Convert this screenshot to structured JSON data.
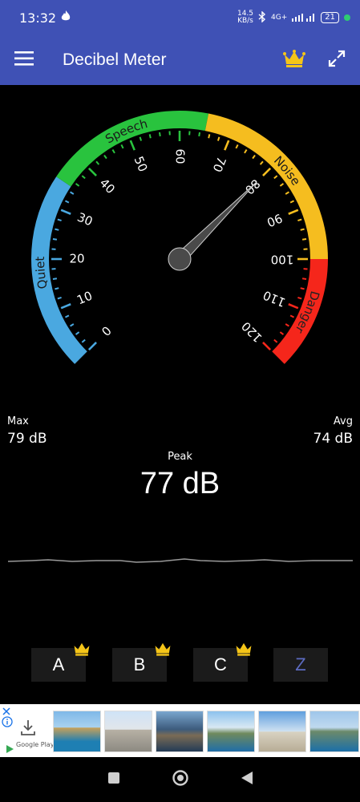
{
  "status": {
    "time": "13:32",
    "net_speed_top": "14.5",
    "net_speed_bottom": "KB/s",
    "network": "4G+",
    "battery": "21"
  },
  "appbar": {
    "title": "Decibel Meter",
    "menu_icon": "hamburger-menu-icon",
    "premium_icon": "crown-icon",
    "fullscreen_icon": "expand-icon"
  },
  "gauge": {
    "min": 0,
    "max": 120,
    "needle_value": 80,
    "ticks": [
      "0",
      "10",
      "20",
      "30",
      "40",
      "50",
      "60",
      "70",
      "80",
      "90",
      "100",
      "110",
      "120"
    ],
    "zones": [
      {
        "label": "Quiet",
        "from": 0,
        "to": 35,
        "color": "#4aa8e0"
      },
      {
        "label": "Speech",
        "from": 35,
        "to": 65,
        "color": "#29c33e"
      },
      {
        "label": "Noise",
        "from": 65,
        "to": 100,
        "color": "#f5bd1f"
      },
      {
        "label": "Danger",
        "from": 100,
        "to": 120,
        "color": "#f5261b"
      }
    ]
  },
  "readings": {
    "max_label": "Max",
    "max_value": "79 dB",
    "avg_label": "Avg",
    "avg_value": "74 dB",
    "peak_label": "Peak",
    "peak_value": "77 dB"
  },
  "weighting": [
    {
      "label": "A",
      "premium": true
    },
    {
      "label": "B",
      "premium": true
    },
    {
      "label": "C",
      "premium": true
    },
    {
      "label": "Z",
      "premium": false
    }
  ],
  "ad": {
    "info_icon": "info-icon",
    "download_icon": "download-icon",
    "store_label": "Google Play"
  },
  "colors": {
    "bar": "#3f51b5",
    "crown": "#f5c518",
    "z_active": "#5c6bc0"
  },
  "navbar": {
    "recents_icon": "square-icon",
    "home_icon": "circle-icon",
    "back_icon": "triangle-back-icon"
  }
}
